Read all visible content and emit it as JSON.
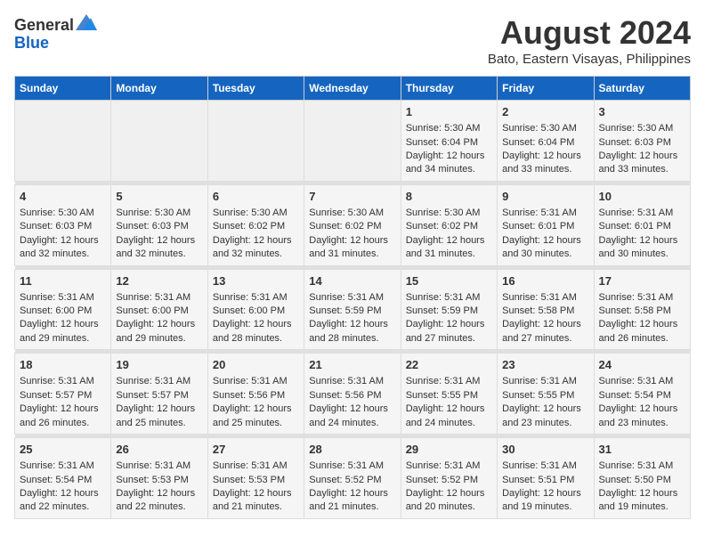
{
  "header": {
    "logo_line1": "General",
    "logo_line2": "Blue",
    "title": "August 2024",
    "subtitle": "Bato, Eastern Visayas, Philippines"
  },
  "days_of_week": [
    "Sunday",
    "Monday",
    "Tuesday",
    "Wednesday",
    "Thursday",
    "Friday",
    "Saturday"
  ],
  "weeks": [
    {
      "cells": [
        {
          "day": "",
          "empty": true
        },
        {
          "day": "",
          "empty": true
        },
        {
          "day": "",
          "empty": true
        },
        {
          "day": "",
          "empty": true
        },
        {
          "day": "1",
          "sunrise": "Sunrise: 5:30 AM",
          "sunset": "Sunset: 6:04 PM",
          "daylight": "Daylight: 12 hours and 34 minutes."
        },
        {
          "day": "2",
          "sunrise": "Sunrise: 5:30 AM",
          "sunset": "Sunset: 6:04 PM",
          "daylight": "Daylight: 12 hours and 33 minutes."
        },
        {
          "day": "3",
          "sunrise": "Sunrise: 5:30 AM",
          "sunset": "Sunset: 6:03 PM",
          "daylight": "Daylight: 12 hours and 33 minutes."
        }
      ]
    },
    {
      "cells": [
        {
          "day": "4",
          "sunrise": "Sunrise: 5:30 AM",
          "sunset": "Sunset: 6:03 PM",
          "daylight": "Daylight: 12 hours and 32 minutes."
        },
        {
          "day": "5",
          "sunrise": "Sunrise: 5:30 AM",
          "sunset": "Sunset: 6:03 PM",
          "daylight": "Daylight: 12 hours and 32 minutes."
        },
        {
          "day": "6",
          "sunrise": "Sunrise: 5:30 AM",
          "sunset": "Sunset: 6:02 PM",
          "daylight": "Daylight: 12 hours and 32 minutes."
        },
        {
          "day": "7",
          "sunrise": "Sunrise: 5:30 AM",
          "sunset": "Sunset: 6:02 PM",
          "daylight": "Daylight: 12 hours and 31 minutes."
        },
        {
          "day": "8",
          "sunrise": "Sunrise: 5:30 AM",
          "sunset": "Sunset: 6:02 PM",
          "daylight": "Daylight: 12 hours and 31 minutes."
        },
        {
          "day": "9",
          "sunrise": "Sunrise: 5:31 AM",
          "sunset": "Sunset: 6:01 PM",
          "daylight": "Daylight: 12 hours and 30 minutes."
        },
        {
          "day": "10",
          "sunrise": "Sunrise: 5:31 AM",
          "sunset": "Sunset: 6:01 PM",
          "daylight": "Daylight: 12 hours and 30 minutes."
        }
      ]
    },
    {
      "cells": [
        {
          "day": "11",
          "sunrise": "Sunrise: 5:31 AM",
          "sunset": "Sunset: 6:00 PM",
          "daylight": "Daylight: 12 hours and 29 minutes."
        },
        {
          "day": "12",
          "sunrise": "Sunrise: 5:31 AM",
          "sunset": "Sunset: 6:00 PM",
          "daylight": "Daylight: 12 hours and 29 minutes."
        },
        {
          "day": "13",
          "sunrise": "Sunrise: 5:31 AM",
          "sunset": "Sunset: 6:00 PM",
          "daylight": "Daylight: 12 hours and 28 minutes."
        },
        {
          "day": "14",
          "sunrise": "Sunrise: 5:31 AM",
          "sunset": "Sunset: 5:59 PM",
          "daylight": "Daylight: 12 hours and 28 minutes."
        },
        {
          "day": "15",
          "sunrise": "Sunrise: 5:31 AM",
          "sunset": "Sunset: 5:59 PM",
          "daylight": "Daylight: 12 hours and 27 minutes."
        },
        {
          "day": "16",
          "sunrise": "Sunrise: 5:31 AM",
          "sunset": "Sunset: 5:58 PM",
          "daylight": "Daylight: 12 hours and 27 minutes."
        },
        {
          "day": "17",
          "sunrise": "Sunrise: 5:31 AM",
          "sunset": "Sunset: 5:58 PM",
          "daylight": "Daylight: 12 hours and 26 minutes."
        }
      ]
    },
    {
      "cells": [
        {
          "day": "18",
          "sunrise": "Sunrise: 5:31 AM",
          "sunset": "Sunset: 5:57 PM",
          "daylight": "Daylight: 12 hours and 26 minutes."
        },
        {
          "day": "19",
          "sunrise": "Sunrise: 5:31 AM",
          "sunset": "Sunset: 5:57 PM",
          "daylight": "Daylight: 12 hours and 25 minutes."
        },
        {
          "day": "20",
          "sunrise": "Sunrise: 5:31 AM",
          "sunset": "Sunset: 5:56 PM",
          "daylight": "Daylight: 12 hours and 25 minutes."
        },
        {
          "day": "21",
          "sunrise": "Sunrise: 5:31 AM",
          "sunset": "Sunset: 5:56 PM",
          "daylight": "Daylight: 12 hours and 24 minutes."
        },
        {
          "day": "22",
          "sunrise": "Sunrise: 5:31 AM",
          "sunset": "Sunset: 5:55 PM",
          "daylight": "Daylight: 12 hours and 24 minutes."
        },
        {
          "day": "23",
          "sunrise": "Sunrise: 5:31 AM",
          "sunset": "Sunset: 5:55 PM",
          "daylight": "Daylight: 12 hours and 23 minutes."
        },
        {
          "day": "24",
          "sunrise": "Sunrise: 5:31 AM",
          "sunset": "Sunset: 5:54 PM",
          "daylight": "Daylight: 12 hours and 23 minutes."
        }
      ]
    },
    {
      "cells": [
        {
          "day": "25",
          "sunrise": "Sunrise: 5:31 AM",
          "sunset": "Sunset: 5:54 PM",
          "daylight": "Daylight: 12 hours and 22 minutes."
        },
        {
          "day": "26",
          "sunrise": "Sunrise: 5:31 AM",
          "sunset": "Sunset: 5:53 PM",
          "daylight": "Daylight: 12 hours and 22 minutes."
        },
        {
          "day": "27",
          "sunrise": "Sunrise: 5:31 AM",
          "sunset": "Sunset: 5:53 PM",
          "daylight": "Daylight: 12 hours and 21 minutes."
        },
        {
          "day": "28",
          "sunrise": "Sunrise: 5:31 AM",
          "sunset": "Sunset: 5:52 PM",
          "daylight": "Daylight: 12 hours and 21 minutes."
        },
        {
          "day": "29",
          "sunrise": "Sunrise: 5:31 AM",
          "sunset": "Sunset: 5:52 PM",
          "daylight": "Daylight: 12 hours and 20 minutes."
        },
        {
          "day": "30",
          "sunrise": "Sunrise: 5:31 AM",
          "sunset": "Sunset: 5:51 PM",
          "daylight": "Daylight: 12 hours and 19 minutes."
        },
        {
          "day": "31",
          "sunrise": "Sunrise: 5:31 AM",
          "sunset": "Sunset: 5:50 PM",
          "daylight": "Daylight: 12 hours and 19 minutes."
        }
      ]
    }
  ]
}
